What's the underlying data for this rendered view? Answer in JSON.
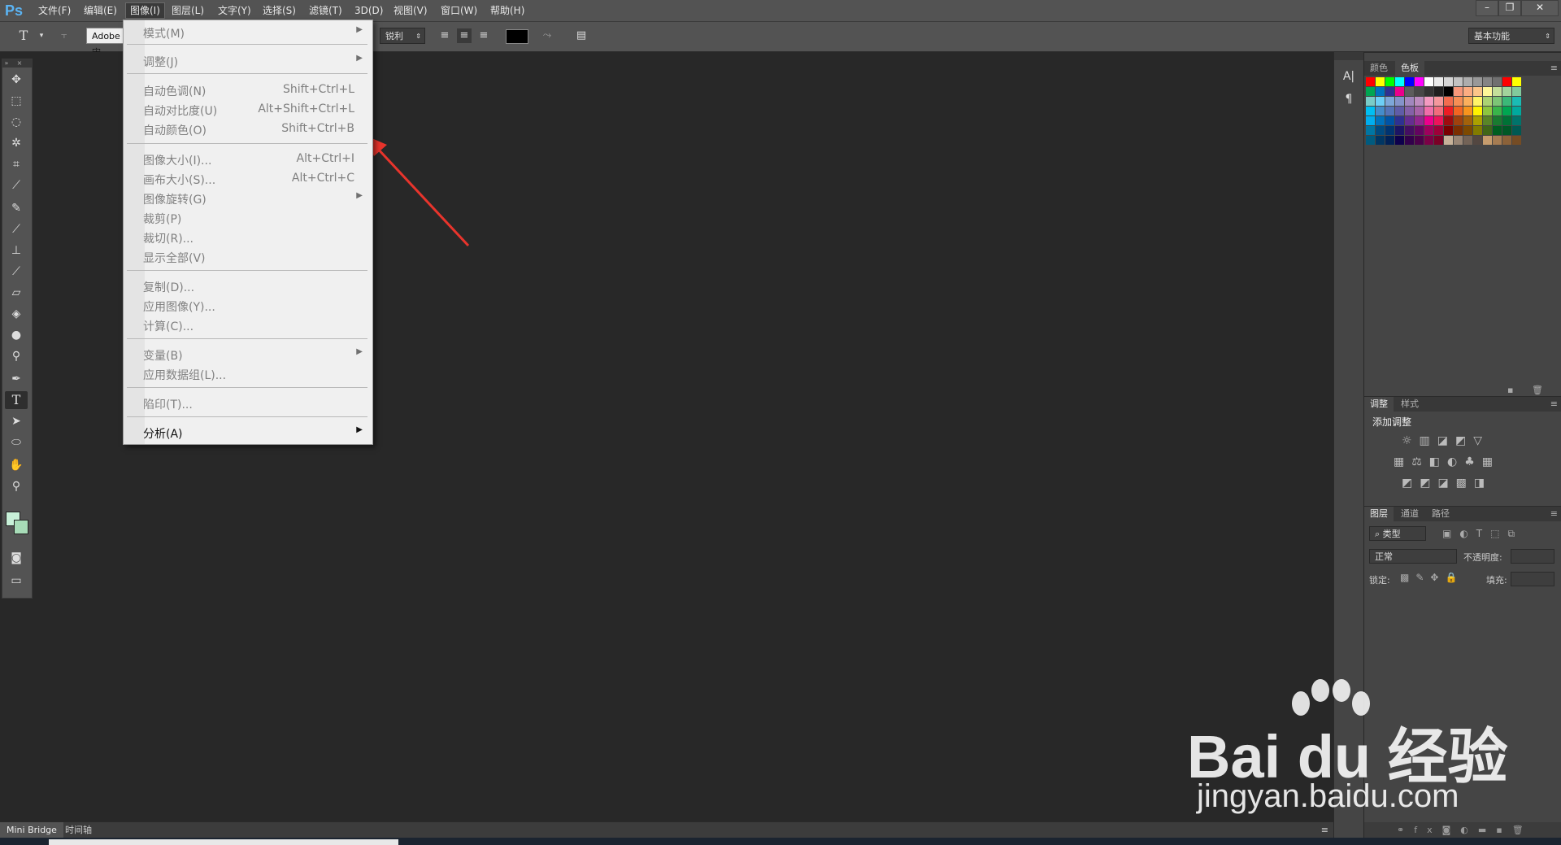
{
  "app": {
    "logo": "Ps"
  },
  "menubar": {
    "items": [
      "文件(F)",
      "编辑(E)",
      "图像(I)",
      "图层(L)",
      "文字(Y)",
      "选择(S)",
      "滤镜(T)",
      "3D(D)",
      "视图(V)",
      "窗口(W)",
      "帮助(H)"
    ],
    "active_index": 2,
    "window_controls": [
      "–",
      "❐",
      "✕"
    ]
  },
  "options_bar": {
    "tool_glyph": "T",
    "font_family": "Adobe 宋",
    "antialias": "锐利",
    "workspace": "基本功能"
  },
  "image_menu": {
    "items": [
      {
        "label": "模式(M)",
        "shortcut": "",
        "submenu": true,
        "enabled": false
      },
      {
        "label": "调整(J)",
        "shortcut": "",
        "submenu": true,
        "enabled": false
      },
      {
        "label": "自动色调(N)",
        "shortcut": "Shift+Ctrl+L",
        "submenu": false,
        "enabled": false
      },
      {
        "label": "自动对比度(U)",
        "shortcut": "Alt+Shift+Ctrl+L",
        "submenu": false,
        "enabled": false
      },
      {
        "label": "自动颜色(O)",
        "shortcut": "Shift+Ctrl+B",
        "submenu": false,
        "enabled": false
      },
      {
        "label": "图像大小(I)...",
        "shortcut": "Alt+Ctrl+I",
        "submenu": false,
        "enabled": false
      },
      {
        "label": "画布大小(S)...",
        "shortcut": "Alt+Ctrl+C",
        "submenu": false,
        "enabled": false
      },
      {
        "label": "图像旋转(G)",
        "shortcut": "",
        "submenu": true,
        "enabled": false
      },
      {
        "label": "裁剪(P)",
        "shortcut": "",
        "submenu": false,
        "enabled": false
      },
      {
        "label": "裁切(R)...",
        "shortcut": "",
        "submenu": false,
        "enabled": false
      },
      {
        "label": "显示全部(V)",
        "shortcut": "",
        "submenu": false,
        "enabled": false
      },
      {
        "label": "复制(D)...",
        "shortcut": "",
        "submenu": false,
        "enabled": false
      },
      {
        "label": "应用图像(Y)...",
        "shortcut": "",
        "submenu": false,
        "enabled": false
      },
      {
        "label": "计算(C)...",
        "shortcut": "",
        "submenu": false,
        "enabled": false
      },
      {
        "label": "变量(B)",
        "shortcut": "",
        "submenu": true,
        "enabled": false
      },
      {
        "label": "应用数据组(L)...",
        "shortcut": "",
        "submenu": false,
        "enabled": false
      },
      {
        "label": "陷印(T)...",
        "shortcut": "",
        "submenu": false,
        "enabled": false
      },
      {
        "label": "分析(A)",
        "shortcut": "",
        "submenu": true,
        "enabled": true
      }
    ]
  },
  "panels": {
    "color": {
      "tabs": [
        "颜色",
        "色板"
      ],
      "active": 1
    },
    "adjust": {
      "tabs": [
        "调整",
        "样式"
      ],
      "active": 0,
      "add_label": "添加调整"
    },
    "layers": {
      "tabs": [
        "图层",
        "通道",
        "路径"
      ],
      "active": 0,
      "filter_kind": "类型",
      "blend_mode": "正常",
      "opacity_label": "不透明度:",
      "lock_label": "锁定:",
      "fill_label": "填充:"
    }
  },
  "bottom_tabs": [
    "Mini Bridge",
    "时间轴"
  ],
  "watermark": {
    "brand": "Bai du 经验",
    "url": "jingyan.baidu.com"
  },
  "colors": {
    "ui_bg": "#535353",
    "doc_bg": "#282828",
    "annotation_arrow": "#e8342c",
    "swatches": [
      [
        "#ff0000",
        "#ffff00",
        "#00ff00",
        "#00ffff",
        "#0000ff",
        "#ff00ff",
        "#ffffff",
        "#ebebeb",
        "#d6d6d6",
        "#c2c2c2",
        "#adadad",
        "#999999",
        "#858585",
        "#707070",
        "#ff0000",
        "#ffff00"
      ],
      [
        "#00a651",
        "#0072bc",
        "#2e3192",
        "#ec008c",
        "#5c5c5c",
        "#474747",
        "#333333",
        "#1f1f1f",
        "#000000",
        "#f7977a",
        "#fbad82",
        "#fdc689",
        "#fff799",
        "#c4df9b",
        "#a3d39c",
        "#82ca9c"
      ],
      [
        "#7accc8",
        "#6dcff6",
        "#7da7d9",
        "#8493ca",
        "#a187be",
        "#bd8cbf",
        "#f49ac1",
        "#f5989d",
        "#f26c4f",
        "#f68e55",
        "#fbaf5c",
        "#fff467",
        "#acd373",
        "#7cc576",
        "#3bb878",
        "#1abbb4"
      ],
      [
        "#00bff3",
        "#448ccb",
        "#5574b9",
        "#605ca8",
        "#8560a8",
        "#a763a8",
        "#f06eaa",
        "#f26d7d",
        "#ed1c24",
        "#f26522",
        "#f7941d",
        "#fff200",
        "#8dc63f",
        "#39b54a",
        "#00a651",
        "#00a99d"
      ],
      [
        "#00aeef",
        "#0072bc",
        "#0054a6",
        "#2e3192",
        "#662d91",
        "#92278f",
        "#ec008c",
        "#ed145b",
        "#9e0b0f",
        "#a0410d",
        "#a3620a",
        "#aba000",
        "#598527",
        "#197b30",
        "#007236",
        "#00746b"
      ],
      [
        "#0076a3",
        "#004a80",
        "#003471",
        "#1b1464",
        "#440e62",
        "#630460",
        "#9e005d",
        "#9e0039",
        "#790000",
        "#7b2e00",
        "#7d4900",
        "#827b00",
        "#406618",
        "#005e20",
        "#005826",
        "#005952"
      ],
      [
        "#005b7f",
        "#003663",
        "#002157",
        "#0d004c",
        "#32004b",
        "#4b0049",
        "#7b0046",
        "#7a0026",
        "#c7b299",
        "#998675",
        "#736357",
        "#534741",
        "#c69c6d",
        "#a67c52",
        "#8c6239",
        "#754c24"
      ]
    ]
  }
}
